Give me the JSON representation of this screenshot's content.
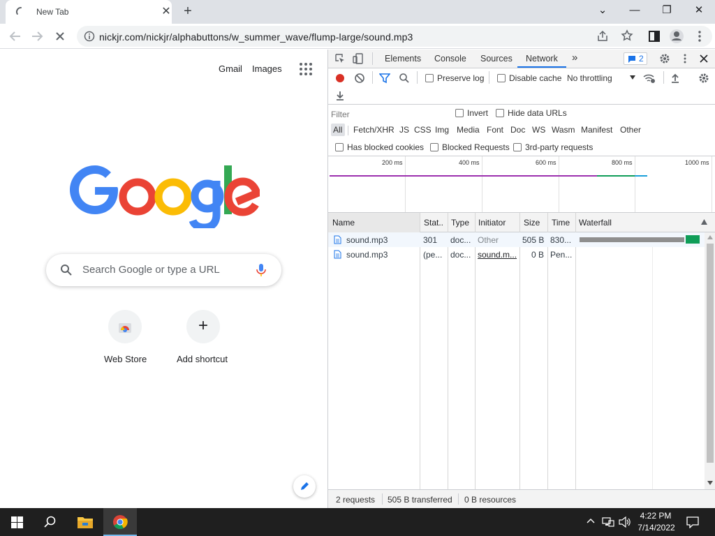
{
  "browser": {
    "tab": {
      "title": "New Tab",
      "close_glyph": "✕"
    },
    "new_tab_glyph": "+",
    "window_controls": {
      "tab_search": "⌄",
      "minimize": "—",
      "restore": "❐",
      "close": "✕"
    },
    "address": "nickjr.com/nickjr/alphabuttons/w_summer_wave/flump-large/sound.mp3"
  },
  "ntp": {
    "links": {
      "gmail": "Gmail",
      "images": "Images"
    },
    "search_placeholder": "Search Google or type a URL",
    "shortcuts": [
      {
        "label": "Web Store",
        "icon": "webstore-icon"
      },
      {
        "label": "Add shortcut",
        "icon": "plus-icon",
        "glyph": "+"
      }
    ],
    "brand_colors": {
      "blue": "#4285f4",
      "red": "#ea4335",
      "yellow": "#fbbc05",
      "green": "#34a853"
    }
  },
  "devtools": {
    "tabs": [
      "Elements",
      "Console",
      "Sources",
      "Network"
    ],
    "more_tabs_glyph": "»",
    "active_tab": "Network",
    "issues_count": "2",
    "toolbar": {
      "preserve_log": "Preserve log",
      "disable_cache": "Disable cache",
      "throttling": "No throttling"
    },
    "filter": {
      "placeholder": "Filter",
      "invert": "Invert",
      "hide_data_urls": "Hide data URLs",
      "types": [
        "All",
        "Fetch/XHR",
        "JS",
        "CSS",
        "Img",
        "Media",
        "Font",
        "Doc",
        "WS",
        "Wasm",
        "Manifest",
        "Other"
      ],
      "has_blocked_cookies": "Has blocked cookies",
      "blocked_requests": "Blocked Requests",
      "third_party": "3rd-party requests"
    },
    "overview_ticks": [
      "200 ms",
      "400 ms",
      "600 ms",
      "800 ms",
      "1000 ms"
    ],
    "columns": [
      "Name",
      "Stat..",
      "Type",
      "Initiator",
      "Size",
      "Time",
      "Waterfall"
    ],
    "requests": [
      {
        "name": "sound.mp3",
        "status": "301",
        "type": "doc...",
        "initiator": "Other",
        "size": "505 B",
        "time": "830..."
      },
      {
        "name": "sound.mp3",
        "status": "(pe...",
        "type": "doc...",
        "initiator": "sound.m...",
        "size": "0 B",
        "time": "Pen..."
      }
    ],
    "status": {
      "requests": "2 requests",
      "transferred": "505 B transferred",
      "resources": "0 B resources"
    }
  },
  "taskbar": {
    "time": "4:22 PM",
    "date": "7/14/2022"
  }
}
